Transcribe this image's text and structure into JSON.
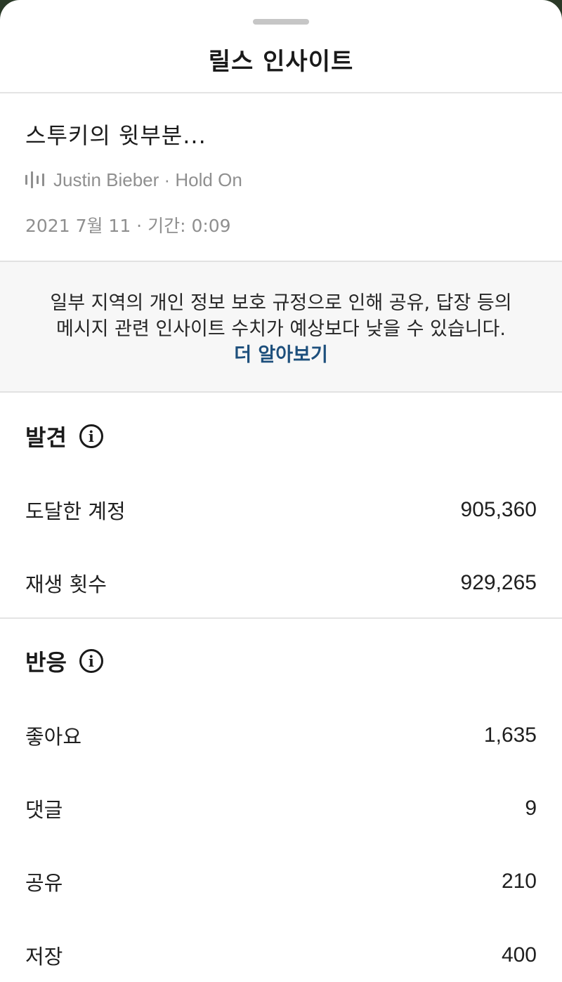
{
  "sheet": {
    "title": "릴스 인사이트"
  },
  "reel": {
    "title": "스투키의 윗부분...",
    "audio": "Justin Bieber · Hold On",
    "date_duration": "2021 7월 11 · 기간: 0:09"
  },
  "notice": {
    "text": "일부 지역의 개인 정보 보호 규정으로 인해 공유, 답장 등의 메시지 관련 인사이트 수치가 예상보다 낮을 수 있습니다. ",
    "link_label": "더 알아보기",
    "link_color": "#1d4f7c"
  },
  "discovery": {
    "title": "발견",
    "info_icon": "info-icon",
    "metrics": [
      {
        "label": "도달한 계정",
        "value": "905,360"
      },
      {
        "label": "재생 횟수",
        "value": "929,265"
      }
    ]
  },
  "engagement": {
    "title": "반응",
    "info_icon": "info-icon",
    "metrics": [
      {
        "label": "좋아요",
        "value": "1,635"
      },
      {
        "label": "댓글",
        "value": "9"
      },
      {
        "label": "공유",
        "value": "210"
      },
      {
        "label": "저장",
        "value": "400"
      }
    ]
  }
}
